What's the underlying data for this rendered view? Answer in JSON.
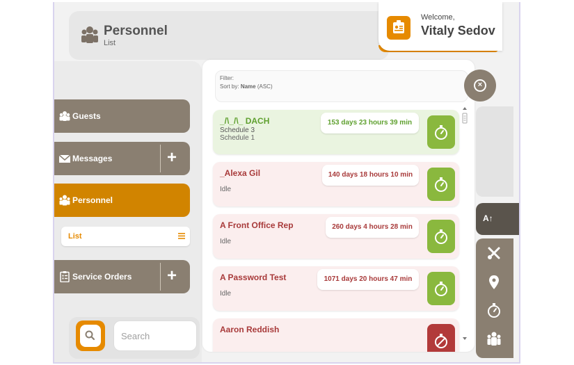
{
  "header": {
    "title": "Personnel",
    "subtitle": "List",
    "welcome_label": "Welcome,",
    "user_name": "Vitaly Sedov"
  },
  "nav": {
    "items": [
      {
        "label": "Guests",
        "icon": "guests-icon",
        "has_plus": false
      },
      {
        "label": "Messages",
        "icon": "envelope-icon",
        "has_plus": true,
        "plus": "+"
      },
      {
        "label": "Personnel",
        "icon": "personnel-icon",
        "has_plus": false,
        "active": true
      },
      {
        "label": "Service Orders",
        "icon": "clipboard-icon",
        "has_plus": true,
        "plus": "+"
      }
    ],
    "sub_item": {
      "label": "List",
      "icon": "list-lines-icon"
    }
  },
  "search": {
    "placeholder": "Search",
    "value": ""
  },
  "filter": {
    "filter_label": "Filter:",
    "sort_label": "Sort by:",
    "sort_value": "Name",
    "sort_dir": "(ASC)",
    "close_glyph": "×"
  },
  "rows": [
    {
      "name": "_/\\_/\\_ DACH",
      "line1": "Schedule 3",
      "line2": "Schedule 1",
      "duration": "153 days 23 hours 39 min",
      "state": "green",
      "action": "timer"
    },
    {
      "name": "_Alexa Gil",
      "status": "Idle",
      "duration": "140 days 18 hours 10 min",
      "state": "pink",
      "action": "timer"
    },
    {
      "name": "A Front Office Rep",
      "status": "Idle",
      "duration": "260 days 4 hours 28 min",
      "state": "pink",
      "action": "timer"
    },
    {
      "name": "A Password Test",
      "status": "Idle",
      "duration": "1071 days 20 hours 47 min",
      "state": "pink",
      "action": "timer"
    },
    {
      "name": "Aaron Reddish",
      "status": "",
      "duration": "",
      "state": "pink",
      "action": "timer-off"
    }
  ],
  "right": {
    "sort_tab_label": "A↑",
    "tools": [
      "tools-icon",
      "location-pin-icon",
      "stopwatch-icon",
      "personnel-icon"
    ]
  },
  "colors": {
    "accent": "#e68a00",
    "nav": "#8a7f71",
    "nav_active": "#d18400",
    "green": "#8ab83e",
    "red": "#b23a3a",
    "dark": "#5a544c"
  }
}
